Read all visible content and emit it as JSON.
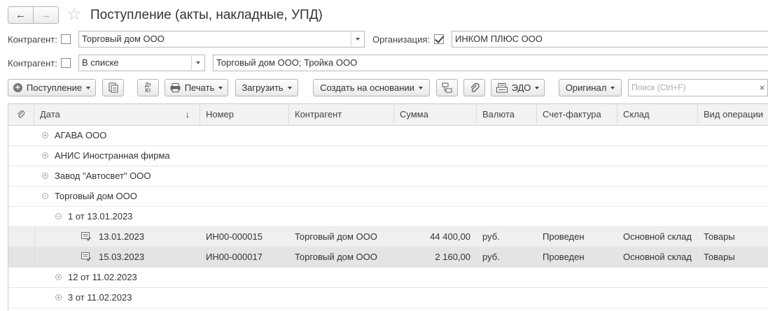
{
  "window": {
    "title": "Поступление (акты, накладные, УПД)",
    "back_glyph": "←",
    "forward_glyph": "→",
    "favorite_glyph": "☆"
  },
  "filters": {
    "row1": {
      "counterparty_label": "Контрагент:",
      "counterparty_value": "Торговый дом ООО",
      "organization_label": "Организация:",
      "organization_value": "ИНКОМ ПЛЮС ООО",
      "organization_checked": true
    },
    "row2": {
      "counterparty_label": "Контрагент:",
      "mode_value": "В списке",
      "list_value": "Торговый дом ООО; Тройка ООО"
    }
  },
  "toolbar": {
    "receipt_label": "Поступление",
    "dtkt_label": "Дт Кт",
    "print_label": "Печать",
    "load_label": "Загрузить",
    "create_based_label": "Создать на основании",
    "edo_label": "ЭДО",
    "original_label": "Оригинал",
    "search_placeholder": "Поиск (Ctrl+F)",
    "search_clear": "×"
  },
  "table": {
    "columns": {
      "date": "Дата",
      "sort_arrow": "↓",
      "number": "Номер",
      "counterparty": "Контрагент",
      "sum": "Сумма",
      "currency": "Валюта",
      "invoice": "Счет-фактура",
      "warehouse": "Склад",
      "operation": "Вид операции"
    },
    "groups": [
      {
        "label": "АГАВА  ООО",
        "expander": "+"
      },
      {
        "label": "АНИС  Иностранная фирма",
        "expander": "+"
      },
      {
        "label": "Завод \"Автосвет\" ООО",
        "expander": "+"
      },
      {
        "label": "Торговый дом ООО",
        "expander": "−"
      }
    ],
    "subgroups": [
      {
        "label": "1 от 13.01.2023",
        "expander": "−"
      },
      {
        "label": "12 от 11.02.2023",
        "expander": "+"
      },
      {
        "label": "3 от 11.02.2023",
        "expander": "+"
      }
    ],
    "docs": [
      {
        "date": "13.01.2023",
        "number": "ИН00-000015",
        "counterparty": "Торговый дом ООО",
        "sum": "44 400,00",
        "currency": "руб.",
        "invoice": "Проведен",
        "warehouse": "Основной склад",
        "operation": "Товары"
      },
      {
        "date": "15.03.2023",
        "number": "ИН00-000017",
        "counterparty": "Торговый дом ООО",
        "sum": "2 160,00",
        "currency": "руб.",
        "invoice": "Проведен",
        "warehouse": "Основной склад",
        "operation": "Товары"
      }
    ]
  }
}
